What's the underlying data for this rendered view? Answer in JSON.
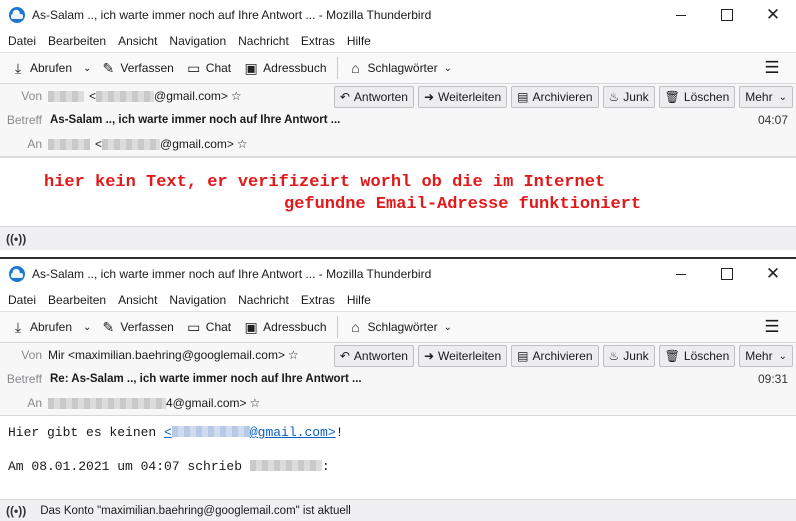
{
  "window1": {
    "title": "As-Salam .., ich warte immer noch auf Ihre Antwort ... - Mozilla Thunderbird",
    "menu": [
      "Datei",
      "Bearbeiten",
      "Ansicht",
      "Navigation",
      "Nachricht",
      "Extras",
      "Hilfe"
    ],
    "toolbar": {
      "abrufen": "Abrufen",
      "verfassen": "Verfassen",
      "chat": "Chat",
      "adressbuch": "Adressbuch",
      "schlagwoerter": "Schlagwörter"
    },
    "header": {
      "from_label": "Von",
      "from_value": "<",
      "from_domain": "@gmail.com>",
      "subject_label": "Betreff",
      "subject": "As-Salam .., ich warte immer noch auf Ihre Antwort ...",
      "time": "04:07",
      "to_label": "An",
      "to_value": "<",
      "to_domain": "@gmail.com>"
    },
    "buttons": {
      "antworten": "Antworten",
      "weiterleiten": "Weiterleiten",
      "archivieren": "Archivieren",
      "junk": "Junk",
      "loeschen": "Löschen",
      "mehr": "Mehr"
    },
    "annotation_line1": "hier kein Text, er verifizeirt worhl ob die im Internet",
    "annotation_line2": "gefundne Email-Adresse funktioniert"
  },
  "window2": {
    "title": "As-Salam .., ich warte immer noch auf Ihre Antwort ... - Mozilla Thunderbird",
    "menu": [
      "Datei",
      "Bearbeiten",
      "Ansicht",
      "Navigation",
      "Nachricht",
      "Extras",
      "Hilfe"
    ],
    "toolbar": {
      "abrufen": "Abrufen",
      "verfassen": "Verfassen",
      "chat": "Chat",
      "adressbuch": "Adressbuch",
      "schlagwoerter": "Schlagwörter"
    },
    "header": {
      "from_label": "Von",
      "from_value": "Mir <maximilian.baehring@googlemail.com>",
      "subject_label": "Betreff",
      "subject": "Re: As-Salam .., ich warte immer noch auf Ihre Antwort ...",
      "time": "09:31",
      "to_label": "An",
      "to_domain": "4@gmail.com>"
    },
    "buttons": {
      "antworten": "Antworten",
      "weiterleiten": "Weiterleiten",
      "archivieren": "Archivieren",
      "junk": "Junk",
      "loeschen": "Löschen",
      "mehr": "Mehr"
    },
    "body": {
      "line1_prefix": "Hier gibt es keinen ",
      "link_open": "<",
      "link_domain": "@gmail.com>",
      "line1_suffix": "!",
      "line2_prefix": "Am 08.01.2021 um 04:07 schrieb",
      "line2_suffix": ":"
    },
    "status": "Das Konto \"maximilian.baehring@googlemail.com\" ist aktuell"
  }
}
